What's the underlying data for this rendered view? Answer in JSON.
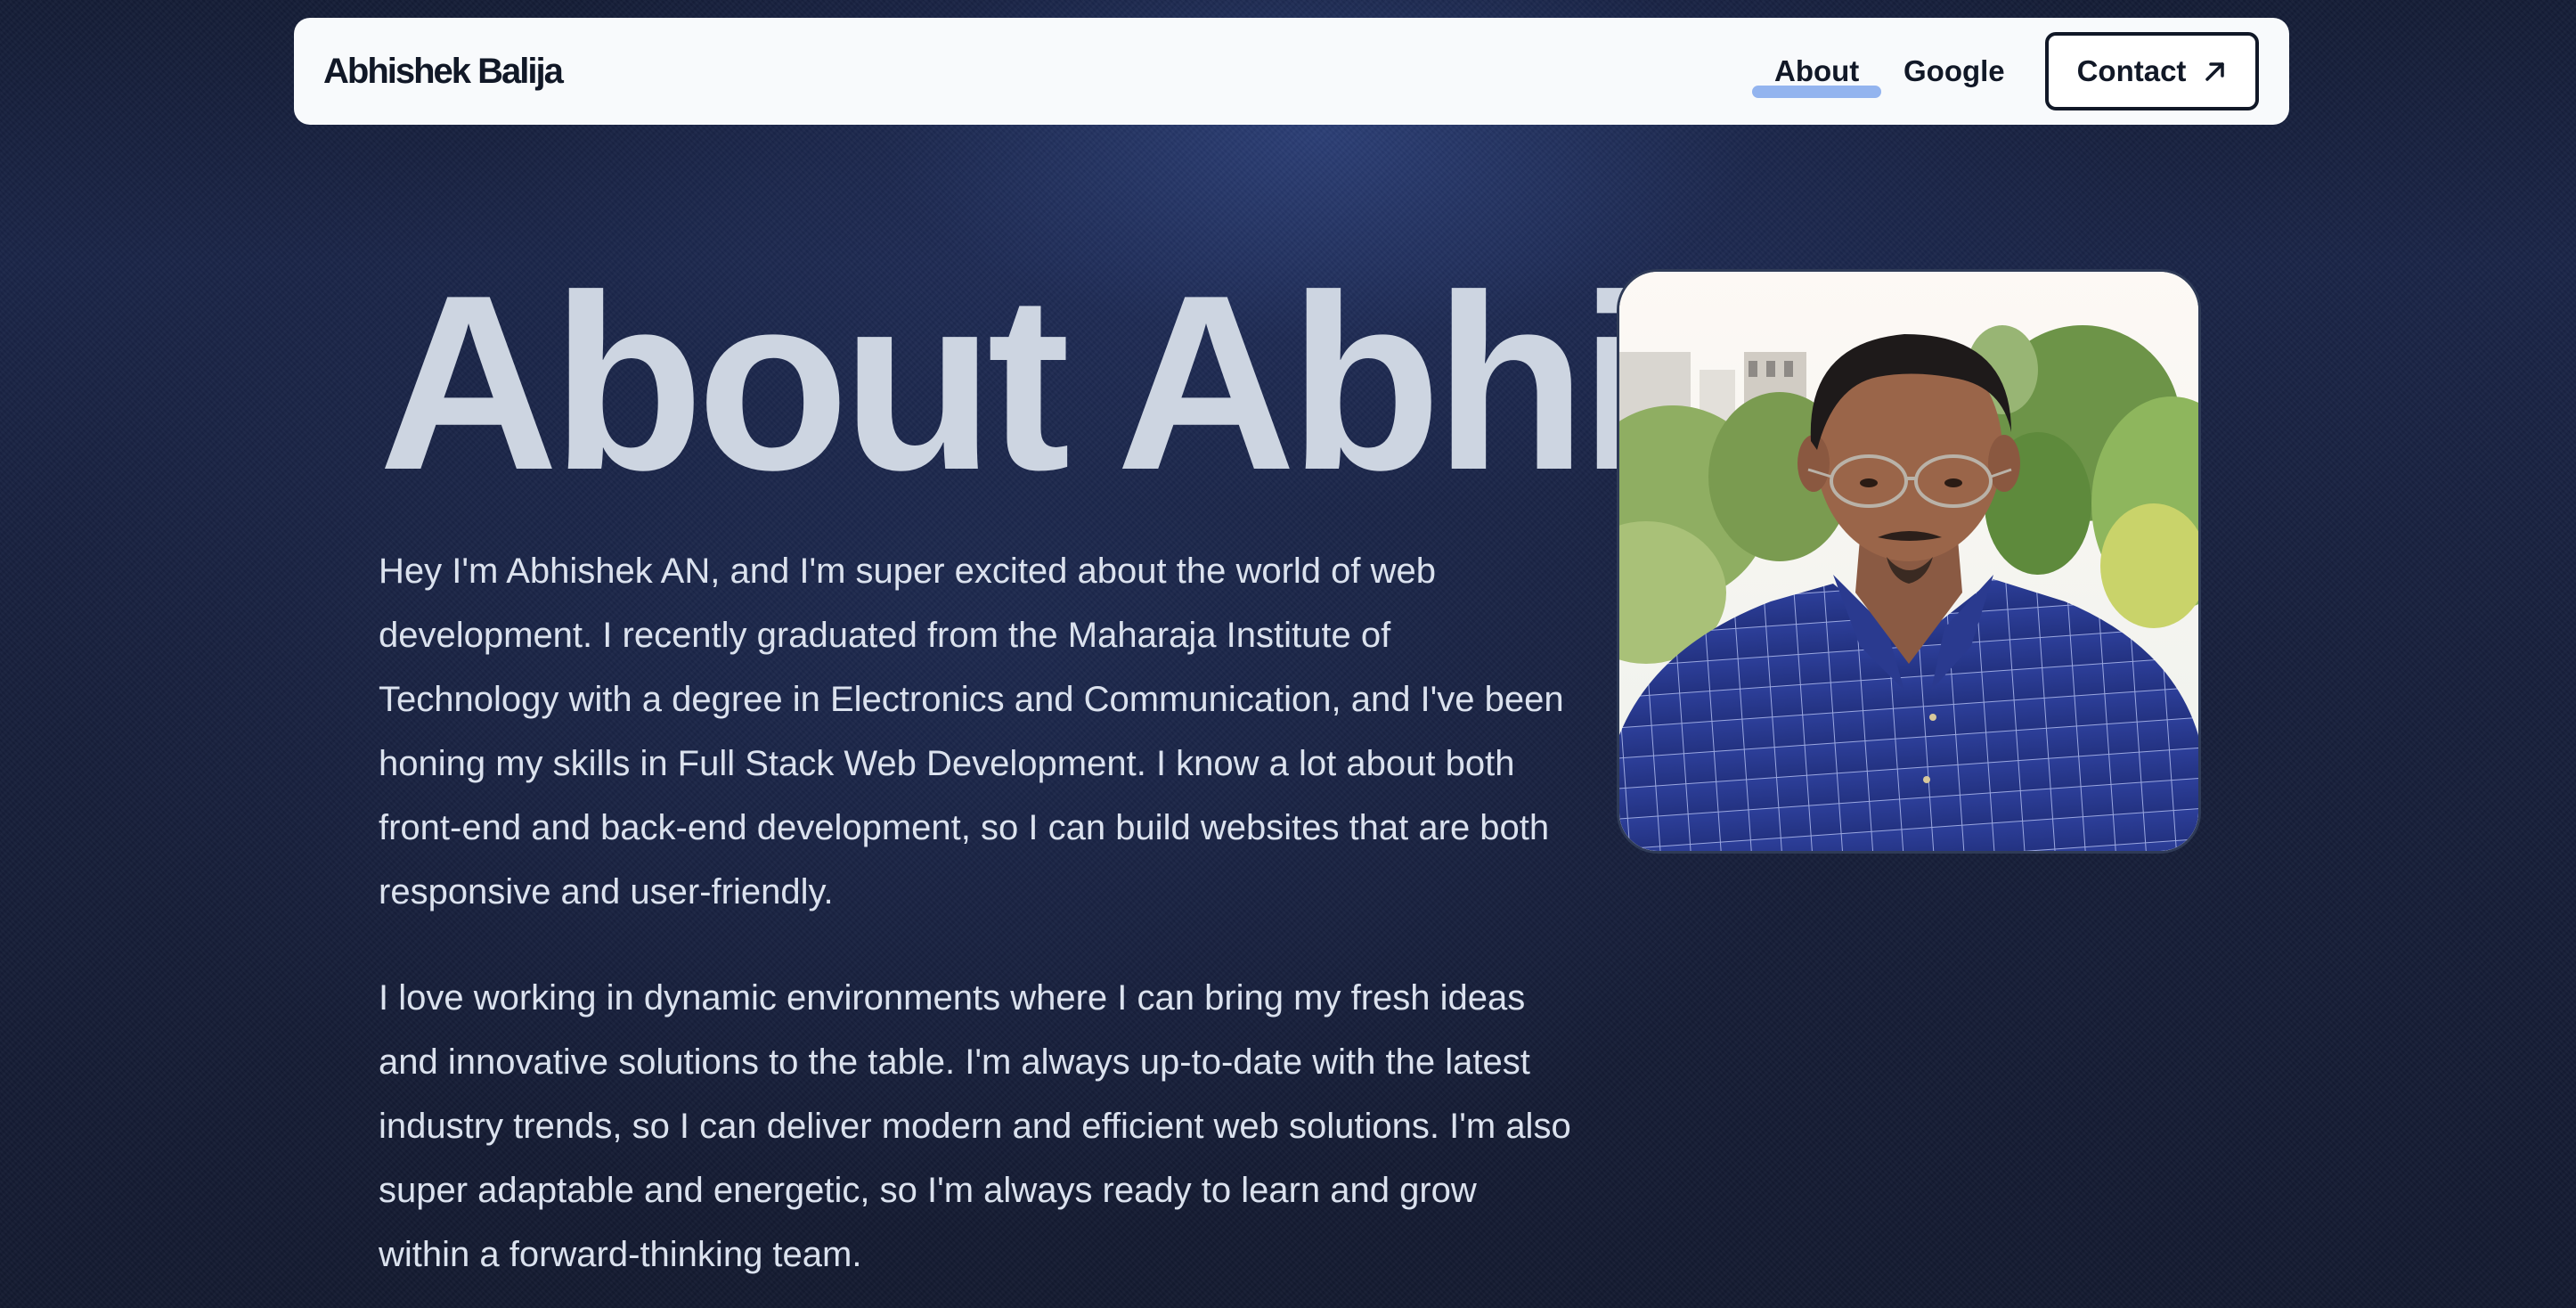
{
  "nav": {
    "brand": "Abhishek Balija",
    "links": [
      {
        "label": "About",
        "active": true
      },
      {
        "label": "Google",
        "active": false
      }
    ],
    "contact_label": "Contact",
    "contact_icon": "arrow-up-right-icon",
    "active_indicator_color": "#93b4ef"
  },
  "hero": {
    "title": "About Abhi",
    "paragraphs": [
      "Hey I'm Abhishek AN, and I'm super excited about the world of web development. I recently graduated from the Maharaja Institute of Technology with a degree in Electronics and Communication, and I've been honing my skills in Full Stack Web Development. I know a lot about both front-end and back-end development, so I can build websites that are both responsive and user-friendly.",
      "I love working in dynamic environments where I can bring my fresh ideas and innovative solutions to the table. I'm always up-to-date with the latest industry trends, so I can deliver modern and efficient web solutions. I'm also super adaptable and energetic, so I'm always ready to learn and grow within a forward-thinking team."
    ]
  },
  "colors": {
    "background": "#121a2e",
    "navbar_bg": "#f8fafc",
    "title_text": "#cdd5e1",
    "body_text": "#dbe2ee",
    "nav_text": "#111827"
  }
}
